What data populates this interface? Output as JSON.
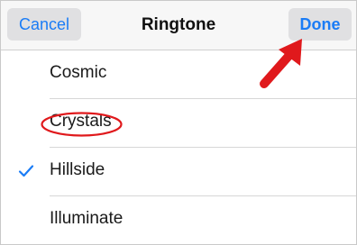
{
  "navbar": {
    "cancel_label": "Cancel",
    "title": "Ringtone",
    "done_label": "Done"
  },
  "ringtones": [
    {
      "label": "Cosmic",
      "selected": false
    },
    {
      "label": "Crystals",
      "selected": false
    },
    {
      "label": "Hillside",
      "selected": true
    },
    {
      "label": "Illuminate",
      "selected": false
    }
  ],
  "icons": {
    "selected_marker": "checkmark-icon",
    "annotation_arrow": "red-arrow-icon",
    "annotation_highlight": "red-oval-highlight"
  },
  "colors": {
    "accent": "#1a7cf6",
    "annotation": "#e0191c"
  }
}
